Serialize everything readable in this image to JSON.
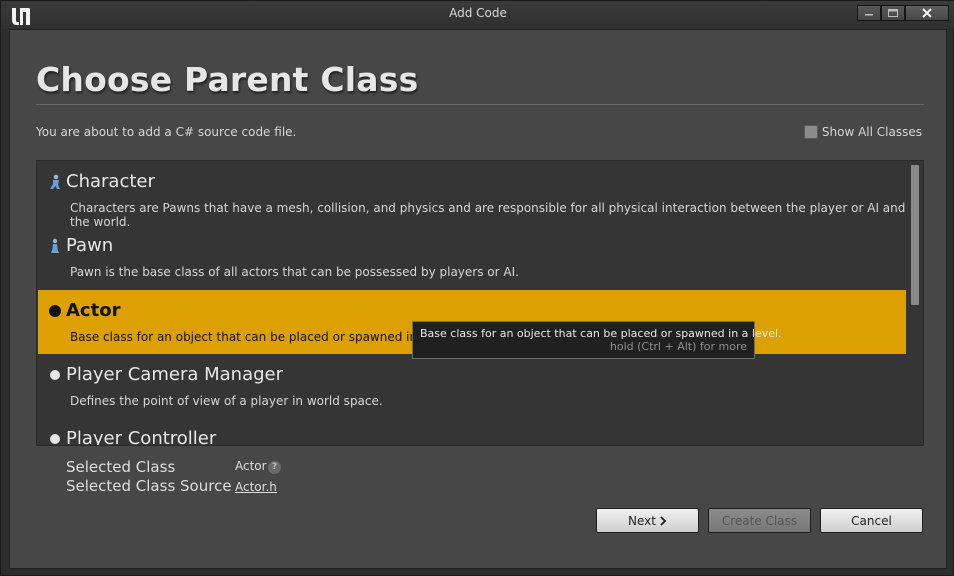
{
  "window": {
    "title": "Add Code"
  },
  "page": {
    "heading": "Choose Parent Class",
    "description": "You are about to add a C# source code file.",
    "show_all_label": "Show All Classes",
    "show_all_checked": false
  },
  "classes": [
    {
      "name": "Character",
      "description": "Characters are Pawns that have a mesh, collision, and physics and are responsible for all physical interaction between the player or AI and the world.",
      "icon": "character-icon"
    },
    {
      "name": "Pawn",
      "description": "Pawn is the base class of all actors that can be possessed by players or AI.",
      "icon": "pawn-icon"
    },
    {
      "name": "Actor",
      "description": "Base class for an object that can be placed or spawned in a level.",
      "icon": "actor-icon",
      "selected": true
    },
    {
      "name": "Player Camera Manager",
      "description": "Defines the point of view of a player in world space.",
      "icon": "sphere-icon"
    },
    {
      "name": "Player Controller",
      "description": "",
      "icon": "sphere-icon"
    }
  ],
  "tooltip": {
    "text": "Base class for an object that can be placed or spawned in a level.",
    "hint": "hold (Ctrl + Alt) for more"
  },
  "selection": {
    "class_label": "Selected Class",
    "class_value": "Actor",
    "source_label": "Selected Class Source",
    "source_value": "Actor.h"
  },
  "buttons": {
    "next": "Next",
    "create": "Create Class",
    "cancel": "Cancel"
  },
  "colors": {
    "selection": "#dca000",
    "panel": "#474747",
    "list": "#353535"
  }
}
